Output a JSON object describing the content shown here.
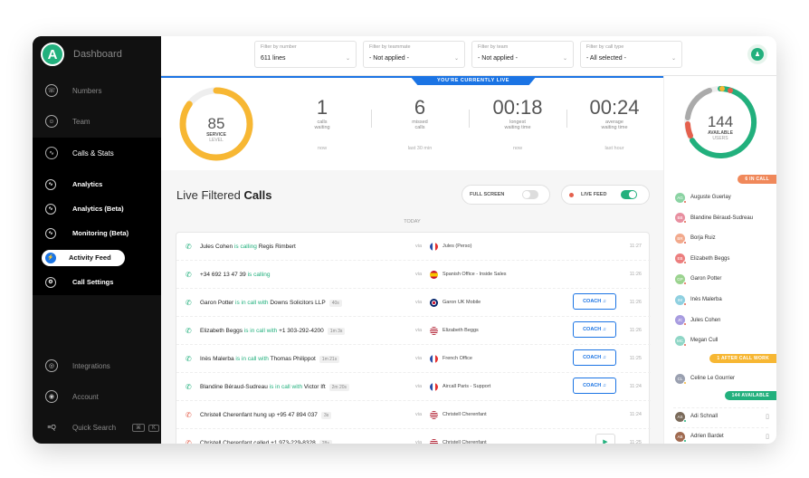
{
  "sidebar": {
    "brand": "Dashboard",
    "items": [
      {
        "label": "Numbers",
        "icon": "phone-icon"
      },
      {
        "label": "Team",
        "icon": "user-icon"
      },
      {
        "label": "Calls & Stats",
        "icon": "stats-icon"
      }
    ],
    "sub": [
      {
        "label": "Analytics"
      },
      {
        "label": "Analytics (Beta)"
      },
      {
        "label": "Monitoring (Beta)"
      },
      {
        "label": "Activity Feed"
      },
      {
        "label": "Call Settings"
      }
    ],
    "bottom": [
      {
        "label": "Integrations"
      },
      {
        "label": "Account"
      },
      {
        "label": "Quick Search"
      }
    ],
    "quick_search_keys": [
      "⌘",
      "K"
    ]
  },
  "filters": [
    {
      "label": "Filter by number",
      "value": "611 lines"
    },
    {
      "label": "Filter by teammate",
      "value": "- Not applied -"
    },
    {
      "label": "Filter by team",
      "value": "- Not applied -"
    },
    {
      "label": "Filter by call type",
      "value": "- All selected -"
    }
  ],
  "banner": "YOU'RE CURRENTLY LIVE",
  "service": {
    "value": "85",
    "label1": "SERVICE",
    "label2": "LEVEL",
    "ring_fraction": 0.85
  },
  "stats": [
    {
      "value": "1",
      "l1": "calls",
      "l2": "waiting",
      "foot": "now"
    },
    {
      "value": "6",
      "l1": "missed",
      "l2": "calls",
      "foot": "last 30 min"
    },
    {
      "value": "00:18",
      "l1": "longest",
      "l2": "waiting time",
      "foot": "now"
    },
    {
      "value": "00:24",
      "l1": "average",
      "l2": "waiting time",
      "foot": "last hour"
    }
  ],
  "available": {
    "value": "144",
    "label1": "AVAILABLE",
    "label2": "USERS"
  },
  "feed": {
    "title_light": "Live Filtered",
    "title_bold": "Calls",
    "full_screen": "FULL SCREEN",
    "live_feed": "LIVE FEED",
    "day": "TODAY",
    "via": "via",
    "coach": "COACH",
    "rows": [
      {
        "parts": [
          [
            "Jules Cohen",
            ""
          ],
          [
            " is calling ",
            "g"
          ],
          [
            "Regis Rimbert",
            ""
          ]
        ],
        "dur": "",
        "flag": "fr",
        "line": "Jules (Perso)",
        "time": "11:27",
        "action": "",
        "missed": false
      },
      {
        "parts": [
          [
            "+34 692 13 47 39",
            ""
          ],
          [
            " is calling",
            "g"
          ]
        ],
        "dur": "",
        "flag": "es",
        "line": "Spanish Office - Inside Sales",
        "time": "11:26",
        "action": "",
        "missed": false
      },
      {
        "parts": [
          [
            "Garon Potter",
            ""
          ],
          [
            " is in call with ",
            "g"
          ],
          [
            "Downs Solicitors LLP",
            ""
          ]
        ],
        "dur": "40s",
        "flag": "gb",
        "line": "Garon UK Mobile",
        "time": "11:26",
        "action": "coach",
        "missed": false
      },
      {
        "parts": [
          [
            "Elizabeth Beggs",
            ""
          ],
          [
            " is in call with ",
            "g"
          ],
          [
            "+1 303-292-4200",
            ""
          ]
        ],
        "dur": "1m 3s",
        "flag": "us",
        "line": "Elizabeth Beggs",
        "time": "11:26",
        "action": "coach",
        "missed": false
      },
      {
        "parts": [
          [
            "Inès Malerba",
            ""
          ],
          [
            " is in call with ",
            "g"
          ],
          [
            "Thomas Philippot",
            ""
          ]
        ],
        "dur": "1m 21s",
        "flag": "fr",
        "line": "French Office",
        "time": "11:25",
        "action": "coach",
        "missed": false
      },
      {
        "parts": [
          [
            "Blandine Béraud-Sudreau",
            ""
          ],
          [
            " is in call with ",
            "g"
          ],
          [
            "Victor Ift",
            ""
          ]
        ],
        "dur": "2m 20s",
        "flag": "fr",
        "line": "Aircall Paris - Support",
        "time": "11:24",
        "action": "coach",
        "missed": false
      },
      {
        "parts": [
          [
            "Christell Cherenfant",
            ""
          ],
          [
            " hung up ",
            ""
          ],
          [
            "+95 47 894 037",
            ""
          ]
        ],
        "dur": "3s",
        "flag": "us",
        "line": "Christell Cherenfant",
        "time": "11:24",
        "action": "",
        "missed": true
      },
      {
        "parts": [
          [
            "Christell Cherenfant",
            ""
          ],
          [
            " called ",
            ""
          ],
          [
            "+1 973-229-8328",
            ""
          ]
        ],
        "dur": "28s",
        "flag": "us",
        "line": "Christell Cherenfant",
        "time": "11:25",
        "action": "play",
        "missed": true
      }
    ]
  },
  "roster": {
    "in_call_tag": "6 IN CALL",
    "after_call_tag": "1 AFTER CALL WORK",
    "available_tag": "144 AVAILABLE",
    "in_call": [
      {
        "initials": "AG",
        "name": "Auguste Guerlay",
        "color": "#8bd3a3"
      },
      {
        "initials": "BB",
        "name": "Blandine Béraud-Sudreau",
        "color": "#e88fa0"
      },
      {
        "initials": "BR",
        "name": "Borja Ruiz",
        "color": "#f2a98c"
      },
      {
        "initials": "EB",
        "name": "Elizabeth Beggs",
        "color": "#ec7e7e"
      },
      {
        "initials": "GP",
        "name": "Garon Potter",
        "color": "#9bd38f"
      },
      {
        "initials": "IM",
        "name": "Inès Malerba",
        "color": "#8fd0e0"
      },
      {
        "initials": "JC",
        "name": "Jules Cohen",
        "color": "#a89ce0"
      },
      {
        "initials": "MC",
        "name": "Megan Cull",
        "color": "#8fd6c6"
      }
    ],
    "after_call": [
      {
        "initials": "CL",
        "name": "Celine Le Gourrier",
        "color": "#9aa0b0"
      }
    ],
    "available": [
      {
        "initials": "AS",
        "name": "Adi Schnall",
        "color": "#7a6a5a"
      },
      {
        "initials": "AB",
        "name": "Adrien Bardet",
        "color": "#a06a50"
      }
    ]
  },
  "colors": {
    "green": "#22b07d",
    "blue": "#1b74e4",
    "orange": "#f7b733",
    "red": "#e4604d"
  }
}
